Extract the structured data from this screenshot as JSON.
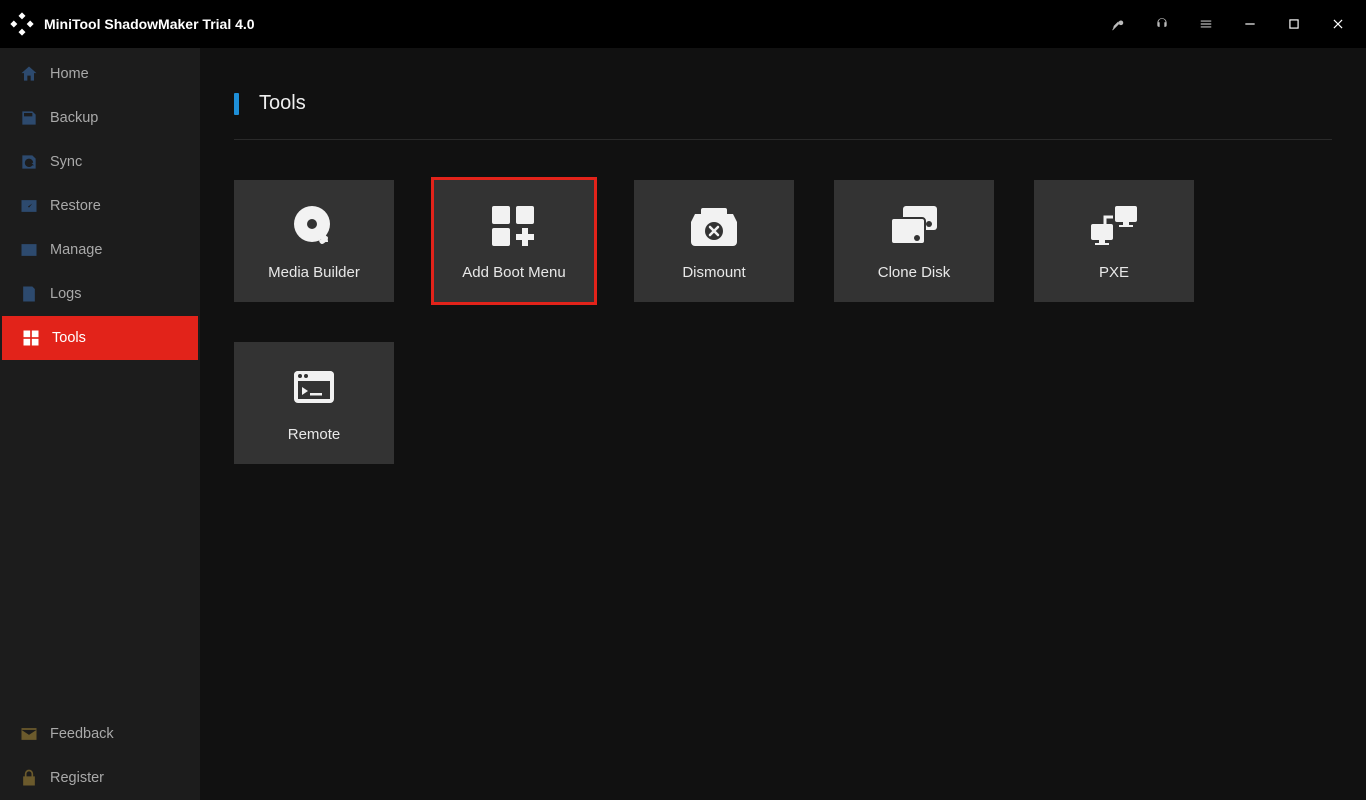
{
  "app": {
    "title": "MiniTool ShadowMaker Trial 4.0"
  },
  "sidebar": {
    "items": [
      {
        "label": "Home"
      },
      {
        "label": "Backup"
      },
      {
        "label": "Sync"
      },
      {
        "label": "Restore"
      },
      {
        "label": "Manage"
      },
      {
        "label": "Logs"
      },
      {
        "label": "Tools"
      }
    ],
    "footer": [
      {
        "label": "Feedback"
      },
      {
        "label": "Register"
      }
    ]
  },
  "page": {
    "title": "Tools"
  },
  "tools": [
    {
      "label": "Media Builder"
    },
    {
      "label": "Add Boot Menu"
    },
    {
      "label": "Dismount"
    },
    {
      "label": "Clone Disk"
    },
    {
      "label": "PXE"
    },
    {
      "label": "Remote"
    }
  ]
}
